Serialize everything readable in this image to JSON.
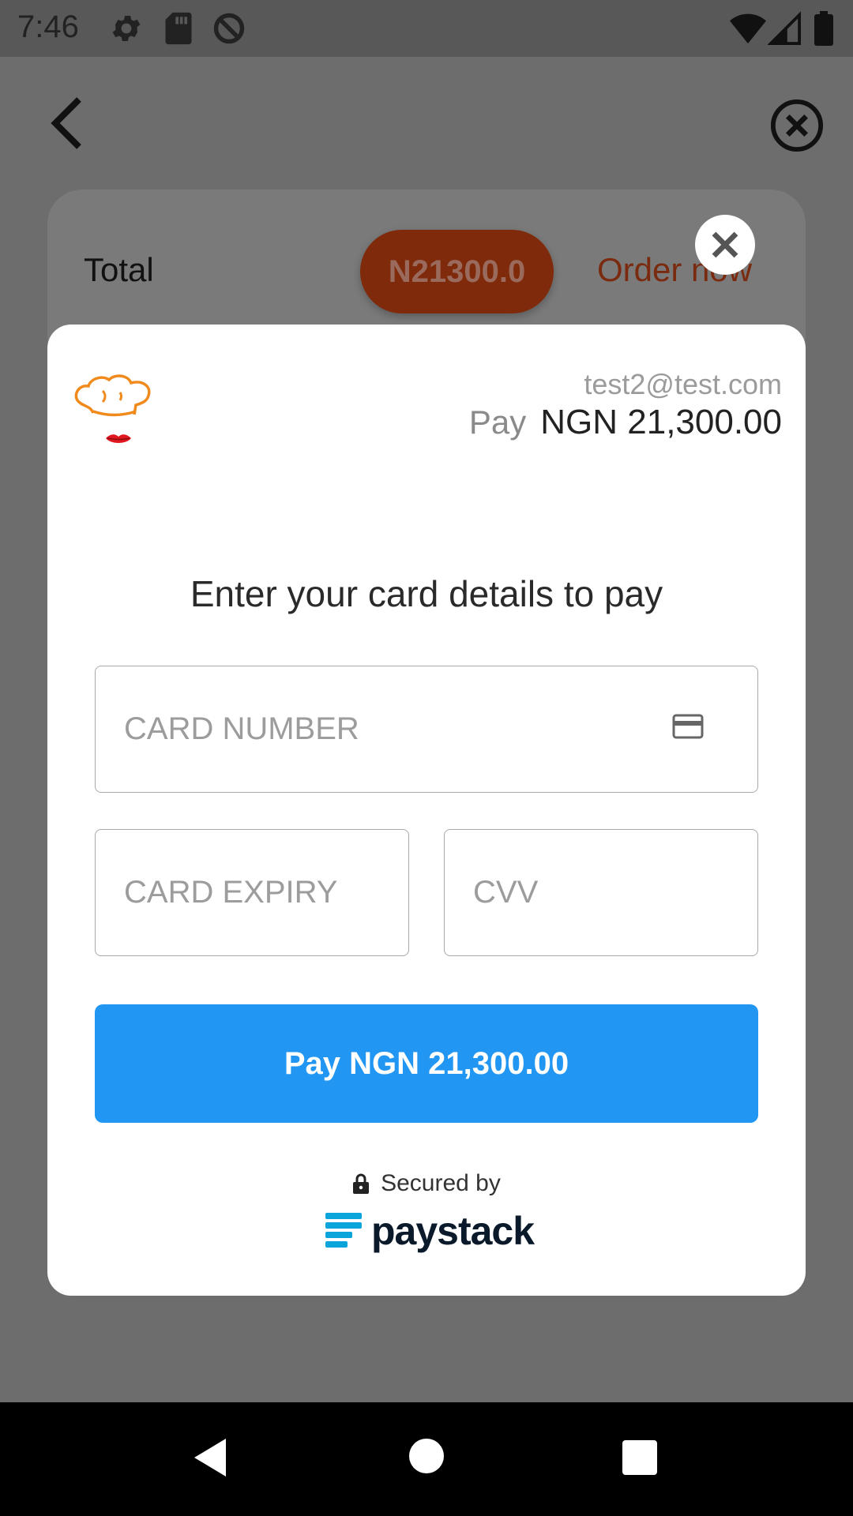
{
  "status_bar": {
    "time": "7:46",
    "icons": [
      "settings-icon",
      "sd-card-icon",
      "data-saver-icon",
      "wifi-icon",
      "cell-signal-icon",
      "battery-icon"
    ]
  },
  "app": {
    "back_icon": "arrow-back-icon",
    "close_icon": "close-circle-icon",
    "total_label": "Total",
    "total_amount": "N21300.0",
    "order_now": "Order now"
  },
  "payment_modal": {
    "close_icon": "close-icon",
    "email": "test2@test.com",
    "pay_label": "Pay",
    "pay_amount": "NGN 21,300.00",
    "headline": "Enter your card details to pay",
    "card_number": {
      "placeholder": "CARD NUMBER",
      "value": ""
    },
    "card_expiry": {
      "placeholder": "CARD EXPIRY",
      "value": ""
    },
    "cvv": {
      "placeholder": "CVV",
      "value": ""
    },
    "pay_button": "Pay NGN 21,300.00",
    "secured_by": "Secured by",
    "brand": "paystack"
  },
  "colors": {
    "primary_button": "#2196f3",
    "total_pill": "#7f2a0b",
    "order_now_text": "#7a2a0e",
    "overlay": "#6d6d6d"
  },
  "nav_bar": {
    "icons": [
      "nav-back-icon",
      "nav-home-icon",
      "nav-recents-icon"
    ]
  }
}
